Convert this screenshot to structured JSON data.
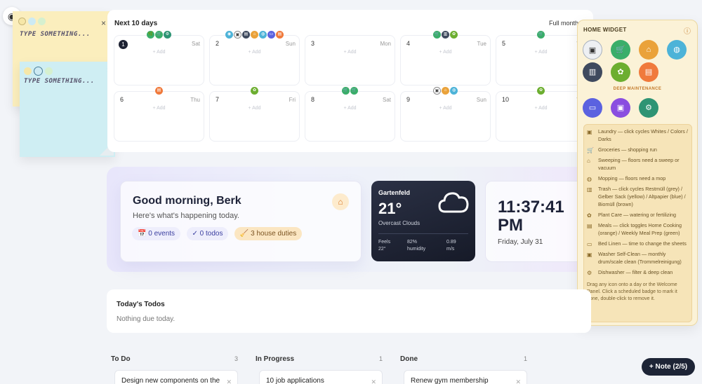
{
  "sticky_notes": [
    {
      "placeholder": "TYPE SOMETHING...",
      "color": "#fbeebd",
      "close": "×"
    },
    {
      "placeholder": "TYPE SOMETHING...",
      "color": "#cfeef3",
      "close": "×"
    }
  ],
  "calendar": {
    "title": "Next 10 days",
    "full_month_link": "Full month",
    "add_label": "+ Add",
    "days": [
      {
        "num": "1",
        "dow": "Sat",
        "icons": [
          [
            "c-green",
            "🌿"
          ],
          [
            "c-green",
            "🛒"
          ],
          [
            "c-teal",
            "⚙"
          ]
        ]
      },
      {
        "num": "2",
        "dow": "Sun",
        "icons": [
          [
            "c-blue",
            "◉"
          ],
          [
            "c-white",
            "▣"
          ],
          [
            "c-navy",
            "▤"
          ],
          [
            "c-orange",
            "⌂"
          ],
          [
            "c-blue",
            "◍"
          ],
          [
            "c-indigo",
            "▭"
          ],
          [
            "c-red",
            "▤"
          ]
        ]
      },
      {
        "num": "3",
        "dow": "Mon",
        "icons": []
      },
      {
        "num": "4",
        "dow": "Tue",
        "icons": [
          [
            "c-green",
            "🛒"
          ],
          [
            "c-navy",
            "▥"
          ],
          [
            "c-lime",
            "✿"
          ]
        ]
      },
      {
        "num": "5",
        "dow": "W",
        "icons": [
          [
            "c-green",
            "🛒"
          ]
        ]
      },
      {
        "num": "6",
        "dow": "Thu",
        "icons": [
          [
            "c-red",
            "▤"
          ]
        ]
      },
      {
        "num": "7",
        "dow": "Fri",
        "icons": [
          [
            "c-lime",
            "✿"
          ]
        ]
      },
      {
        "num": "8",
        "dow": "Sat",
        "icons": [
          [
            "c-green",
            "🛒"
          ],
          [
            "c-green",
            "🛒"
          ]
        ]
      },
      {
        "num": "9",
        "dow": "Sun",
        "icons": [
          [
            "c-white",
            "▣"
          ],
          [
            "c-orange",
            "⌂"
          ],
          [
            "c-blue",
            "◍"
          ]
        ]
      },
      {
        "num": "10",
        "dow": "W",
        "icons": [
          [
            "c-lime",
            "✿"
          ]
        ]
      }
    ]
  },
  "greeting": {
    "title": "Good morning, Berk",
    "subtitle": "Here's what's happening today.",
    "events": "📅 0 events",
    "todos": "✓ 0 todos",
    "duties": "🧹 3 house duties"
  },
  "weather": {
    "city": "Gartenfeld",
    "temp": "21°",
    "condition": "Overcast Clouds",
    "feels_label": "Feels",
    "feels_value": "22°",
    "humidity_value": "82%",
    "humidity_label": "humidity",
    "wind_value": "0.89",
    "wind_unit": "m/s"
  },
  "clock": {
    "time": "11:37:41",
    "ampm": "PM",
    "date": "Friday, July 31"
  },
  "home_widget": {
    "title": "HOME WIDGET",
    "info": "ⓘ",
    "deep_maintenance": "DEEP MAINTENANCE",
    "legend": [
      {
        "glyph": "▣",
        "text": "Laundry — click cycles Whites / Colors / Darks"
      },
      {
        "glyph": "🛒",
        "text": "Groceries — shopping run"
      },
      {
        "glyph": "⌂",
        "text": "Sweeping — floors need a sweep or vacuum"
      },
      {
        "glyph": "◍",
        "text": "Mopping — floors need a mop"
      },
      {
        "glyph": "▥",
        "text": "Trash — click cycles Restmüll (grey) / Gelber Sack (yellow) / Altpapier (blue) / Biomüll (brown)"
      },
      {
        "glyph": "✿",
        "text": "Plant Care — watering or fertilizing"
      },
      {
        "glyph": "▤",
        "text": "Meals — click toggles Home Cooking (orange) / Weekly Meal Prep (green)"
      },
      {
        "glyph": "▭",
        "text": "Bed Linen — time to change the sheets"
      },
      {
        "glyph": "▣",
        "text": "Washer Self-Clean — monthly drum/scale clean (Trommelreinigung)"
      },
      {
        "glyph": "⚙",
        "text": "Dishwasher — filter & deep clean"
      }
    ],
    "hint": "Drag any icon onto a day or the Welcome Panel. Click a scheduled badge to mark it done, double-click to remove it."
  },
  "todays_todos": {
    "title": "Today's Todos",
    "empty": "Nothing due today."
  },
  "kanban": [
    {
      "title": "To Do",
      "count": "3",
      "card": "Design new components on the"
    },
    {
      "title": "In Progress",
      "count": "1",
      "card": "10 job applications"
    },
    {
      "title": "Done",
      "count": "1",
      "card": "Renew gym membership"
    }
  ],
  "note_button": "+ Note (2/5)"
}
